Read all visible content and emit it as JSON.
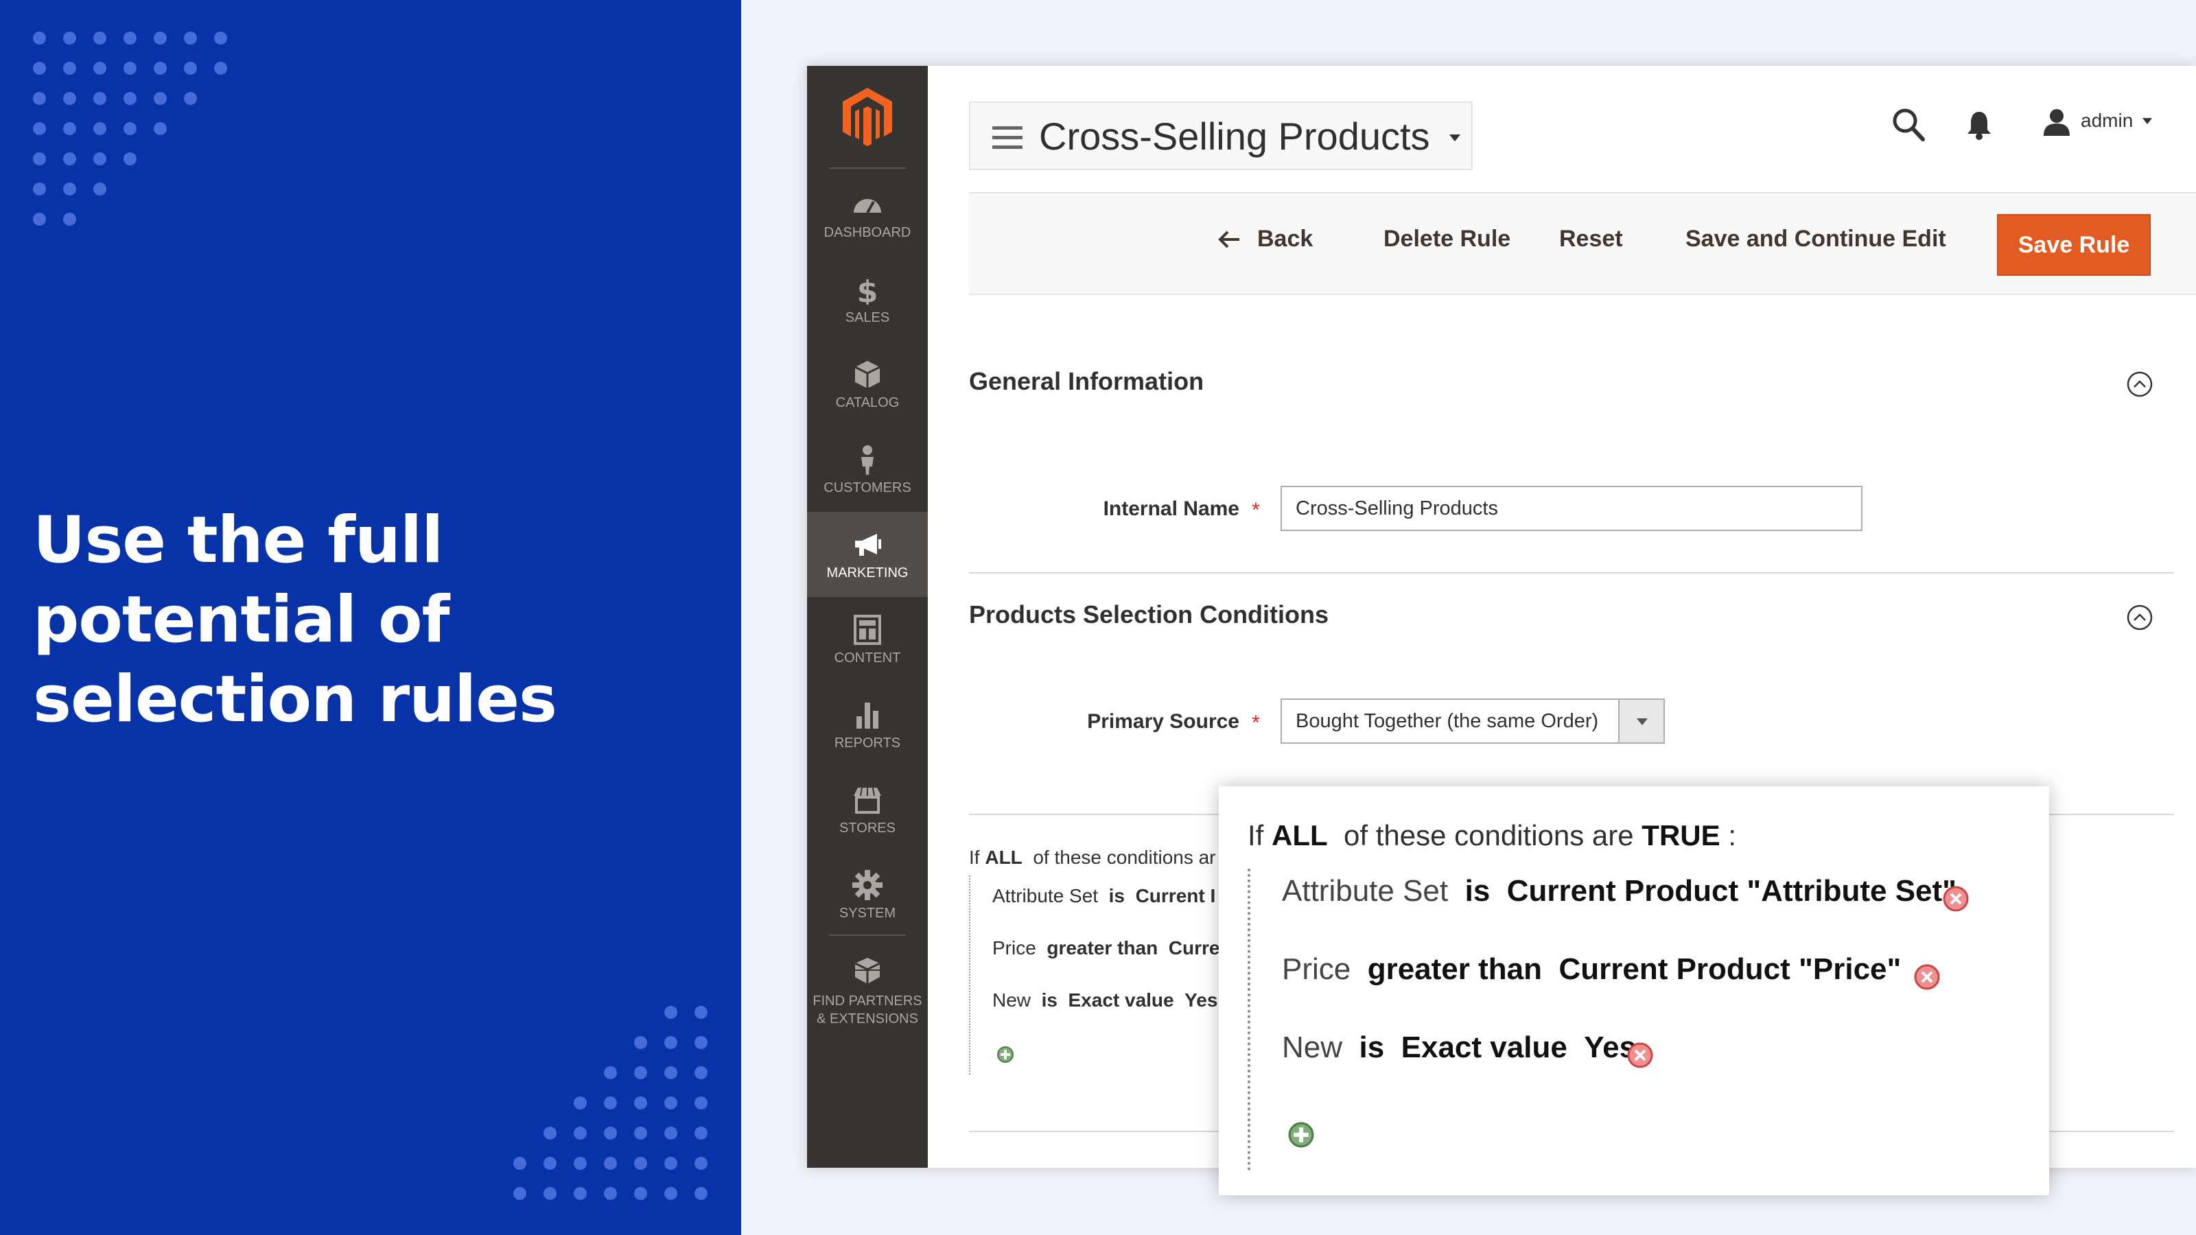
{
  "promo": {
    "headline": [
      "Use the full",
      "potential of",
      "selection rules"
    ]
  },
  "sidebar": {
    "items": [
      {
        "label": "DASHBOARD",
        "icon": "dashboard-icon"
      },
      {
        "label": "SALES",
        "icon": "dollar-icon"
      },
      {
        "label": "CATALOG",
        "icon": "catalog-box-icon"
      },
      {
        "label": "CUSTOMERS",
        "icon": "customer-person-icon"
      },
      {
        "label": "MARKETING",
        "icon": "megaphone-icon",
        "active": true
      },
      {
        "label": "CONTENT",
        "icon": "content-layout-icon"
      },
      {
        "label": "REPORTS",
        "icon": "bar-chart-icon"
      },
      {
        "label": "STORES",
        "icon": "store-icon"
      },
      {
        "label": "SYSTEM",
        "icon": "gear-icon"
      },
      {
        "label": "FIND PARTNERS",
        "label2": "& EXTENSIONS",
        "icon": "extensions-boxes-icon"
      }
    ]
  },
  "header": {
    "title": "Cross-Selling Products",
    "user": "admin"
  },
  "toolbar": {
    "back": "Back",
    "delete": "Delete Rule",
    "reset": "Reset",
    "save_continue": "Save and Continue Edit",
    "save": "Save Rule"
  },
  "general": {
    "title": "General Information",
    "internal_name_label": "Internal Name",
    "internal_name_value": "Cross-Selling Products"
  },
  "selection": {
    "title": "Products Selection Conditions",
    "primary_source_label": "Primary Source",
    "primary_source_value": "Bought Together (the same Order)"
  },
  "conditions_bg": {
    "if": "If",
    "all": "ALL",
    "rest": "of these conditions ar",
    "rows": [
      {
        "attr": "Attribute Set",
        "op": "is",
        "val": "Current I"
      },
      {
        "attr": "Price",
        "op": "greater than",
        "val": "Curre"
      },
      {
        "attr": "New",
        "op": "is",
        "val": "Exact value",
        "val2": "Yes"
      }
    ]
  },
  "conditions": {
    "if": "If",
    "all": "ALL",
    "middle": "of these conditions are",
    "true_word": "TRUE",
    "colon": ":",
    "rows": [
      {
        "attr": "Attribute Set",
        "op": "is",
        "value": "Current Product \"Attribute Set\""
      },
      {
        "attr": "Price",
        "op": "greater than",
        "value": "Current Product \"Price\""
      },
      {
        "attr": "New",
        "op": "is",
        "value": "Exact value",
        "value2": "Yes"
      }
    ]
  },
  "colors": {
    "promo_bg": "#0833a8",
    "sidebar_bg": "#373330",
    "accent": "#e15b23",
    "page_bg": "#f1f3fa"
  }
}
